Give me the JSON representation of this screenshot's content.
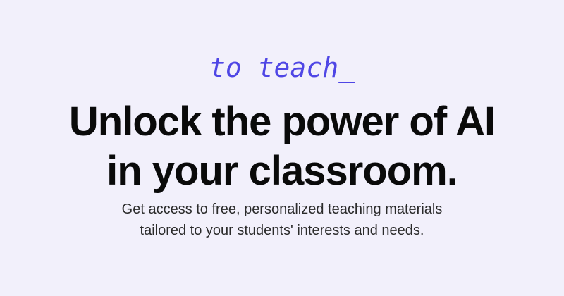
{
  "brand": {
    "name": "to teach_"
  },
  "headline": {
    "line1": "Unlock the power of AI",
    "line2": "in your classroom."
  },
  "subtext": {
    "line1": "Get access to free, personalized teaching materials",
    "line2": "tailored to your students' interests and needs."
  },
  "colors": {
    "background": "#f2f0fb",
    "accent": "#4f46e5",
    "heading": "#0a0a0a",
    "body": "#2b2b2b"
  }
}
